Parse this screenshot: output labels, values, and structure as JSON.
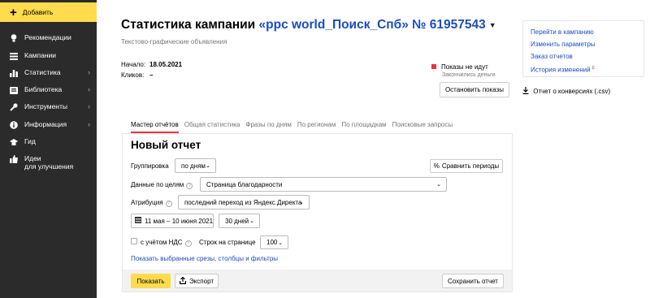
{
  "sidebar": {
    "add_label": "Добавить",
    "items": [
      {
        "label": "Рекомендации",
        "icon": "lightbulb-icon"
      },
      {
        "label": "Кампании",
        "icon": "list-icon"
      },
      {
        "label": "Статистика",
        "icon": "bar-chart-icon"
      },
      {
        "label": "Библиотека",
        "icon": "folder-icon"
      },
      {
        "label": "Инструменты",
        "icon": "wrench-icon"
      },
      {
        "label": "Информация",
        "icon": "info-icon"
      },
      {
        "label": "Гид",
        "icon": "graduation-cap-icon"
      },
      {
        "label_line1": "Идеи",
        "label_line2": "для улучшения",
        "icon": "thumbs-up-icon"
      }
    ]
  },
  "header": {
    "title_prefix": "Статистика кампании ",
    "campaign_name": "«ppc world_Поиск_Спб» № 61957543",
    "subtitle": "Текстово-графические объявления",
    "start_label": "Начало:",
    "start_value": "18.05.2021",
    "clicks_label": "Кликов:",
    "clicks_value": "–"
  },
  "status": {
    "text": "Показы не идут",
    "subtext": "Закончились деньги",
    "stop_button": "Остановить показы"
  },
  "right_links": {
    "go_campaign": "Перейти в кампанию",
    "change_params": "Изменить параметры",
    "order_report": "Заказ отчетов",
    "history": "История изменений",
    "history_badge": "β",
    "conversions": "Отчет о конверсиях (.csv)"
  },
  "tabs": [
    "Мастер отчётов",
    "Общая статистика",
    "Фразы по дням",
    "По регионам",
    "По площадкам",
    "Поисковые запросы"
  ],
  "report": {
    "title": "Новый отчет",
    "grouping_label": "Группировка",
    "grouping_value": "по дням",
    "compare_button": "Сравнить периоды",
    "goals_label": "Данные по целям",
    "goals_value": "Страница благодарности",
    "attribution_label": "Атрибуция",
    "attribution_value": "последний переход из Яндекс.Директа",
    "date_range": "11 мая – 10 июня 2021",
    "period_value": "30 дней",
    "vat_label": "с учётом НДС",
    "rows_label": "Строк на странице",
    "rows_value": "100",
    "filters_link": "Показать выбранные срезы, столбцы и фильтры",
    "show_button": "Показать",
    "export_button": "Экспорт",
    "save_button": "Сохранить отчет"
  },
  "colors": {
    "sidebar_bg": "#2b2b2b",
    "accent_yellow": "#ffdb4d",
    "link_blue": "#1a4dbf",
    "status_red": "#e8353a"
  }
}
